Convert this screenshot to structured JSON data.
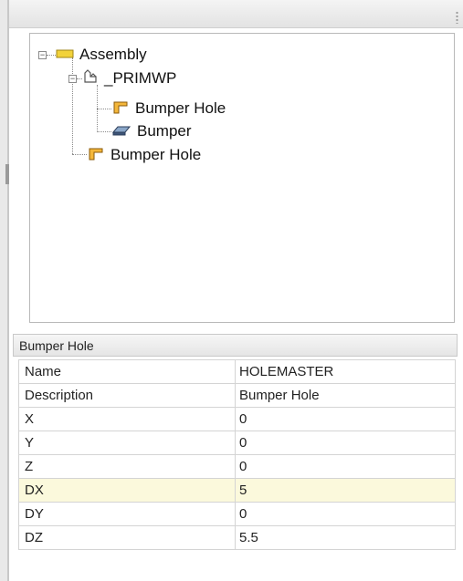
{
  "tree": {
    "nodes": [
      {
        "id": "assembly",
        "label": "Assembly",
        "icon": "assembly-icon",
        "expanded": true
      },
      {
        "id": "primwp",
        "label": "_PRIMWP",
        "icon": "workplane-icon",
        "expanded": true
      },
      {
        "id": "bumper-hole-child",
        "label": "Bumper Hole",
        "icon": "hole-icon"
      },
      {
        "id": "bumper",
        "label": "Bumper",
        "icon": "solid-icon"
      },
      {
        "id": "bumper-hole",
        "label": "Bumper Hole",
        "icon": "hole-icon"
      }
    ]
  },
  "properties": {
    "title": "Bumper Hole",
    "rows": [
      {
        "name": "Name",
        "value": "HOLEMASTER"
      },
      {
        "name": "Description",
        "value": "Bumper Hole"
      },
      {
        "name": "X",
        "value": "0"
      },
      {
        "name": "Y",
        "value": "0"
      },
      {
        "name": "Z",
        "value": "0"
      },
      {
        "name": "DX",
        "value": "5"
      },
      {
        "name": "DY",
        "value": "0"
      },
      {
        "name": "DZ",
        "value": "5.5"
      }
    ],
    "selected_row": "DX"
  },
  "colors": {
    "selected_row_bg": "#fbf9dc",
    "assembly_icon": "#f2d23a",
    "hole_icon": "#e0a21e"
  }
}
